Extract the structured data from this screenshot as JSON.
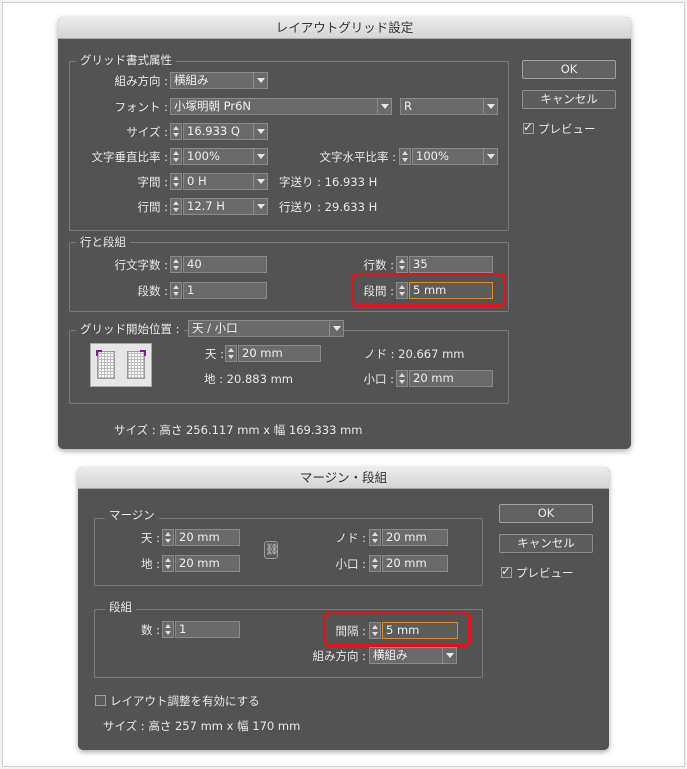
{
  "dialog1": {
    "title": "レイアウトグリッド設定",
    "grid_format": {
      "title": "グリッド書式属性",
      "direction_label": "組み方向 :",
      "direction_value": "横組み",
      "font_label": "フォント :",
      "font_value": "小塚明朝 Pr6N",
      "font_style_value": "R",
      "size_label": "サイズ :",
      "size_value": "16.933 Q",
      "vscale_label": "文字垂直比率 :",
      "vscale_value": "100%",
      "hscale_label": "文字水平比率 :",
      "hscale_value": "100%",
      "char_space_label": "字間 :",
      "char_space_value": "0 H",
      "char_pitch_text": "字送り : 16.933 H",
      "line_space_label": "行間 :",
      "line_space_value": "12.7 H",
      "line_pitch_text": "行送り : 29.633 H"
    },
    "lines_columns": {
      "title": "行と段組",
      "chars_per_line_label": "行文字数 :",
      "chars_per_line_value": "40",
      "lines_label": "行数 :",
      "lines_value": "35",
      "columns_label": "段数 :",
      "columns_value": "1",
      "gutter_label": "段間 :",
      "gutter_value": "5 mm"
    },
    "grid_start": {
      "title": "グリッド開始位置 :",
      "position_value": "天 / 小口",
      "top_label": "天 :",
      "top_value": "20 mm",
      "inside_text": "ノド : 20.667 mm",
      "bottom_text": "地 : 20.883 mm",
      "outside_label": "小口 :",
      "outside_value": "20 mm"
    },
    "size_text": "サイズ : 高さ 256.117 mm x 幅 169.333 mm",
    "ok_label": "OK",
    "cancel_label": "キャンセル",
    "preview_label": "プレビュー"
  },
  "dialog2": {
    "title": "マージン・段組",
    "margins": {
      "title": "マージン",
      "top_label": "天 :",
      "top_value": "20 mm",
      "bottom_label": "地 :",
      "bottom_value": "20 mm",
      "inside_label": "ノド :",
      "inside_value": "20 mm",
      "outside_label": "小口 :",
      "outside_value": "20 mm"
    },
    "columns": {
      "title": "段組",
      "number_label": "数 :",
      "number_value": "1",
      "gutter_label": "間隔 :",
      "gutter_value": "5 mm",
      "direction_label": "組み方向 :",
      "direction_value": "横組み"
    },
    "layout_adjust_label": "レイアウト調整を有効にする",
    "size_text": "サイズ : 高さ 257 mm x 幅 170 mm",
    "ok_label": "OK",
    "cancel_label": "キャンセル",
    "preview_label": "プレビュー"
  },
  "colors": {
    "dialog_bg": "#535353",
    "highlight": "#e3111b",
    "focus_border": "#e08a2e"
  }
}
